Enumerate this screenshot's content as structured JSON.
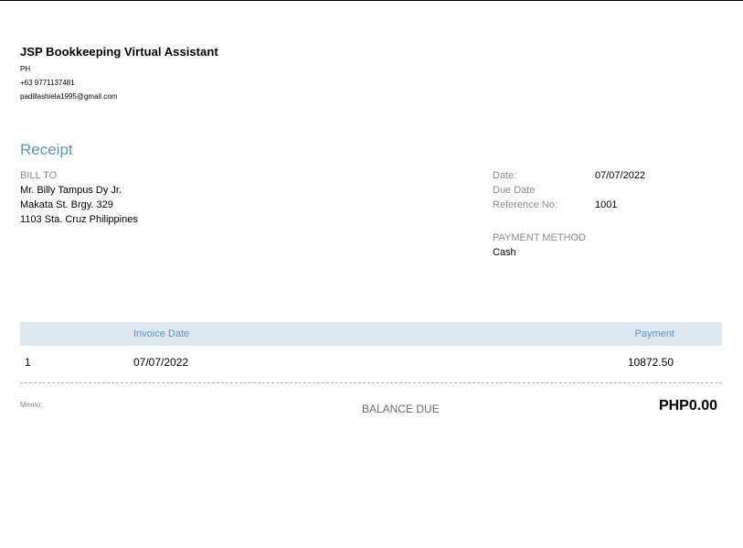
{
  "company": {
    "name": "JSP Bookkeeping Virtual Assistant",
    "country": "PH",
    "phone": "+63 9771137481",
    "email": "padillashiela1995@gmail.com"
  },
  "document": {
    "title": "Receipt"
  },
  "bill_to": {
    "label": "BILL TO",
    "lines": [
      "Mr. Billy Tampus Dy Jr.",
      "Makata St. Brgy. 329",
      "1103 Sta. Cruz Philippines"
    ]
  },
  "details": {
    "date_label": "Date:",
    "date_value": "07/07/2022",
    "due_date_label": "Due Date",
    "reference_label": "Reference No:",
    "reference_value": "1001"
  },
  "payment": {
    "method_label": "PAYMENT METHOD",
    "method_value": "Cash"
  },
  "table": {
    "columns": [
      "",
      "Invoice Date",
      "Payment"
    ],
    "rows": [
      [
        "1",
        "07/07/2022",
        "10872.50"
      ]
    ]
  },
  "footer": {
    "memo_label": "Memo:",
    "balance_label": "BALANCE DUE",
    "balance_value": "PHP0.00"
  },
  "colors": {
    "accent": "#5a96bd",
    "header_fill": "#dde8f0",
    "muted_text": "#8a8a8a"
  }
}
